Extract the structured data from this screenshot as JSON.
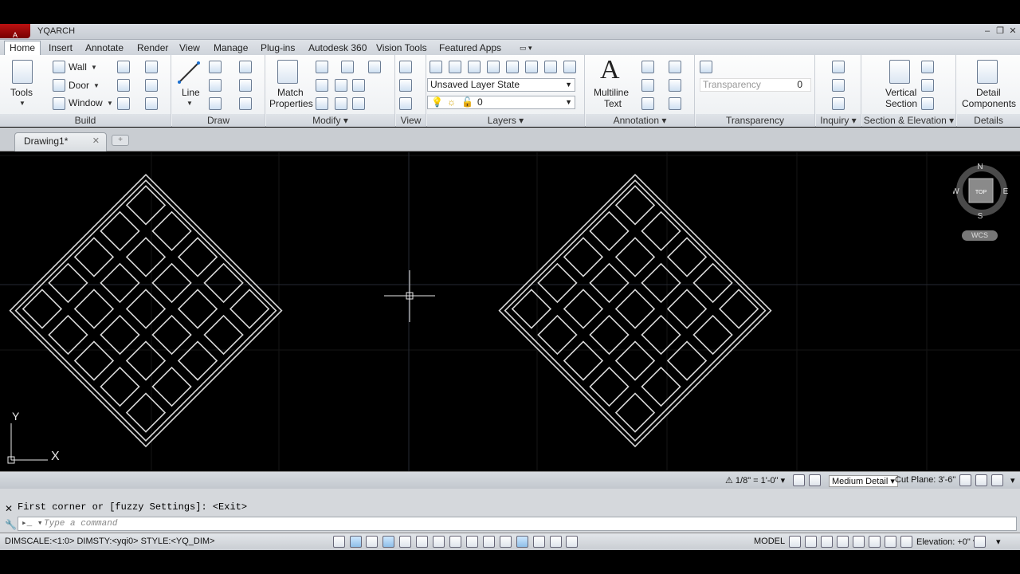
{
  "app": {
    "logo": "A",
    "title": "YQARCH"
  },
  "tabs": [
    "Home",
    "Insert",
    "Annotate",
    "Render",
    "View",
    "Manage",
    "Plug-ins",
    "Autodesk 360",
    "Vision Tools",
    "Featured Apps"
  ],
  "ribbon": {
    "tools_label": "Tools",
    "build": {
      "label": "Build",
      "wall": "Wall",
      "door": "Door",
      "window": "Window"
    },
    "draw": {
      "label": "Draw",
      "line": "Line"
    },
    "modify": {
      "label": "Modify",
      "match_line1": "Match",
      "match_line2": "Properties"
    },
    "view": {
      "label": "View"
    },
    "layers": {
      "label": "Layers",
      "layer_state": "Unsaved Layer State",
      "current_layer": "0"
    },
    "annotation": {
      "label": "Annotation",
      "mtext_line1": "Multiline",
      "mtext_line2": "Text"
    },
    "transparency": {
      "label": "Transparency",
      "field": "Transparency",
      "value": "0"
    },
    "inquiry": {
      "label": "Inquiry"
    },
    "section": {
      "label": "Section & Elevation",
      "vs_line1": "Vertical",
      "vs_line2": "Section"
    },
    "details": {
      "label": "Details",
      "dc_line1": "Detail",
      "dc_line2": "Components"
    }
  },
  "document": {
    "tab": "Drawing1*",
    "close": "✕",
    "new_tab": "+"
  },
  "viewcube": {
    "n": "N",
    "s": "S",
    "e": "E",
    "w": "W",
    "face": "TOP",
    "wcs": "WCS"
  },
  "ucs": {
    "y": "Y",
    "x": "X"
  },
  "annobar": {
    "scale": "1/8\" = 1'-0\"",
    "detail": "Medium Detail",
    "cut_plane": "Cut Plane: 3'-6\""
  },
  "command": {
    "history": "First corner or [fuzzy Settings]: <Exit>",
    "placeholder": "Type a command"
  },
  "status": {
    "left": "DIMSCALE:<1:0> DIMSTY:<yqi0> STYLE:<YQ_DIM>",
    "model": "MODEL",
    "elevation": "Elevation: +0\""
  }
}
